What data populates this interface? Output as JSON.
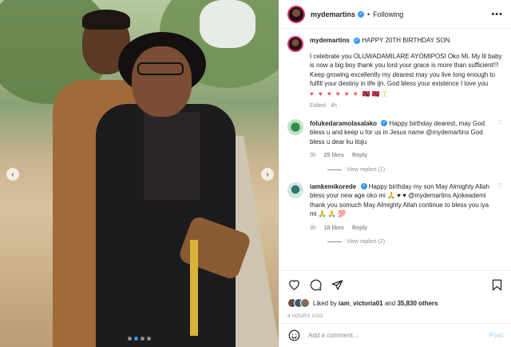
{
  "header": {
    "username": "mydemartins",
    "separator": "•",
    "follow_label": "Following",
    "more_label": "•••"
  },
  "caption": {
    "username": "mydemartins",
    "title": "HAPPY 20TH BIRTHDAY SON",
    "body": "I celebrate you OLUWADAMILARE AYOMIPOSI Oko Mi. My lil baby is now a big boy thank you lord your grace is more than sufficient!!! Keep growing excellently my dearest may you live long enough to fulfill your destiny in life ijn. God bless your existence I love you",
    "hearts": "♥ ♥ ♥ ♥ ♥ ♥",
    "extra": "🇹🇹🇹🇹🇹",
    "meta": "Edited · 4h"
  },
  "comments": [
    {
      "username": "folukedaramolasalako",
      "text": "Happy birthday dearest, may God bless u and keep u for us in Jesus name @mydemartins God bless u dear ku itoju",
      "time": "3h",
      "likes": "25 likes",
      "reply_label": "Reply",
      "view_replies": "View replies (1)"
    },
    {
      "username": "iamkemikorede",
      "text": "Happy birthday my son May Almighty Allah bless your new age oko mi 🙏 ♥ ♥ @mydemartins Ajokeademi thank you somuch May Almighty Allah continue to bless you iya mi 🙏 🙏 💯",
      "time": "3h",
      "likes": "18 likes",
      "reply_label": "Reply",
      "view_replies": "View replies (2)"
    }
  ],
  "likes": {
    "prefix": "Liked by",
    "user": "iam_victoria01",
    "middle": "and",
    "count": "35,830 others"
  },
  "timestamp": "4 HOURS AGO",
  "comment_box": {
    "placeholder": "Add a comment...",
    "post_label": "Post"
  },
  "carousel": {
    "prev_icon": "chevron-left-icon",
    "next_icon": "chevron-right-icon",
    "active_index": 1,
    "count": 4
  },
  "colors": {
    "accent": "#3797f0",
    "heart": "#ed4956",
    "muted": "#8e8e8e"
  }
}
